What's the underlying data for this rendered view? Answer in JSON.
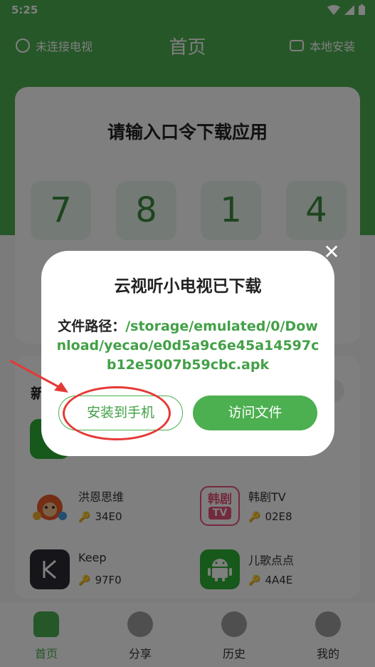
{
  "status_bar": {
    "time": "5:25"
  },
  "header": {
    "left_label": "未连接电视",
    "title": "首页",
    "right_label": "本地安装"
  },
  "code_card": {
    "heading": "请输入口令下载应用",
    "digits": [
      "7",
      "8",
      "1",
      "4"
    ]
  },
  "new_section": {
    "label": "新"
  },
  "apps": [
    {
      "name": "洪恩思维",
      "code": "34E0",
      "icon": "monkey-icon"
    },
    {
      "name": "韩剧TV",
      "code": "02E8",
      "icon": "korean-drama-tv-icon"
    },
    {
      "name": "Keep",
      "code": "97F0",
      "icon": "keep-k-icon"
    },
    {
      "name": "儿歌点点",
      "code": "4A4E",
      "icon": "android-icon"
    }
  ],
  "icon_text": {
    "korean_tv_top": "韩剧",
    "korean_tv_bottom": "TV"
  },
  "dialog": {
    "title": "云视听小电视已下载",
    "path_label": "文件路径：",
    "path_value": "/storage/emulated/0/Download/yecao/e0d5a9c6e45a14597cb12e5007b59cbc.apk",
    "install_button": "安装到手机",
    "visit_button": "访问文件",
    "close_glyph": "✕"
  },
  "bottom_nav": [
    {
      "label": "首页",
      "active": true
    },
    {
      "label": "分享",
      "active": false
    },
    {
      "label": "历史",
      "active": false
    },
    {
      "label": "我的",
      "active": false
    }
  ],
  "colors": {
    "brand_green": "#4caf50",
    "annotation_red": "#e53935"
  }
}
